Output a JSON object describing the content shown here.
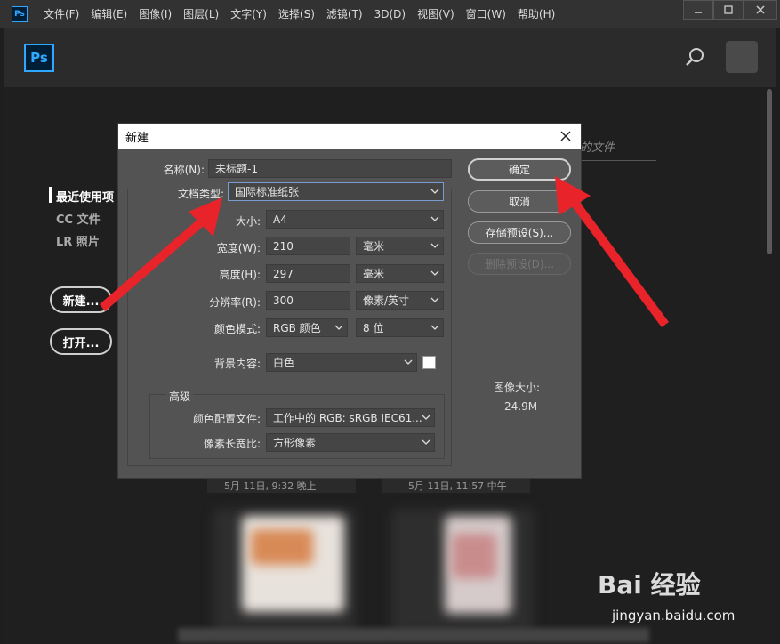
{
  "menubar": {
    "app_icon": "Ps",
    "items": [
      "文件(F)",
      "编辑(E)",
      "图像(I)",
      "图层(L)",
      "文字(Y)",
      "选择(S)",
      "滤镜(T)",
      "3D(D)",
      "视图(V)",
      "窗口(W)",
      "帮助(H)"
    ],
    "window_controls": [
      "minimize-icon",
      "maximize-icon",
      "close-icon"
    ]
  },
  "home": {
    "logo": "Ps",
    "sidebar": [
      "最近使用项",
      "CC 文件",
      "LR 照片"
    ],
    "new_button": "新建...",
    "open_button": "打开...",
    "recent_header_fragment": "的文件",
    "thumbnails": [
      {
        "label": "5月 11日, 9:32 晚上"
      },
      {
        "label": "5月 11日, 11:57 中午"
      }
    ]
  },
  "dialog": {
    "title": "新建",
    "name_label": "名称(N):",
    "name_value": "未标题-1",
    "doc_type_label": "文档类型:",
    "doc_type_value": "国际标准纸张",
    "size_label": "大小:",
    "size_value": "A4",
    "width_label": "宽度(W):",
    "width_value": "210",
    "width_unit": "毫米",
    "height_label": "高度(H):",
    "height_value": "297",
    "height_unit": "毫米",
    "resolution_label": "分辨率(R):",
    "resolution_value": "300",
    "resolution_unit": "像素/英寸",
    "color_mode_label": "颜色模式:",
    "color_mode_value": "RGB 颜色",
    "bit_depth_value": "8 位",
    "background_label": "背景内容:",
    "background_value": "白色",
    "advanced_label": "高级",
    "color_profile_label": "颜色配置文件:",
    "color_profile_value": "工作中的 RGB: sRGB IEC61...",
    "pixel_aspect_label": "像素长宽比:",
    "pixel_aspect_value": "方形像素",
    "buttons": {
      "ok": "确定",
      "cancel": "取消",
      "save_preset": "存储预设(S)...",
      "delete_preset": "删除预设(D)..."
    },
    "image_size_label": "图像大小:",
    "image_size_value": "24.9M"
  },
  "watermark": {
    "logo": "Bai 经验",
    "url": "jingyan.baidu.com"
  },
  "colors": {
    "arrow": "#e8232a",
    "ps_blue": "#31a8ff",
    "dialog_bg": "#535353"
  }
}
